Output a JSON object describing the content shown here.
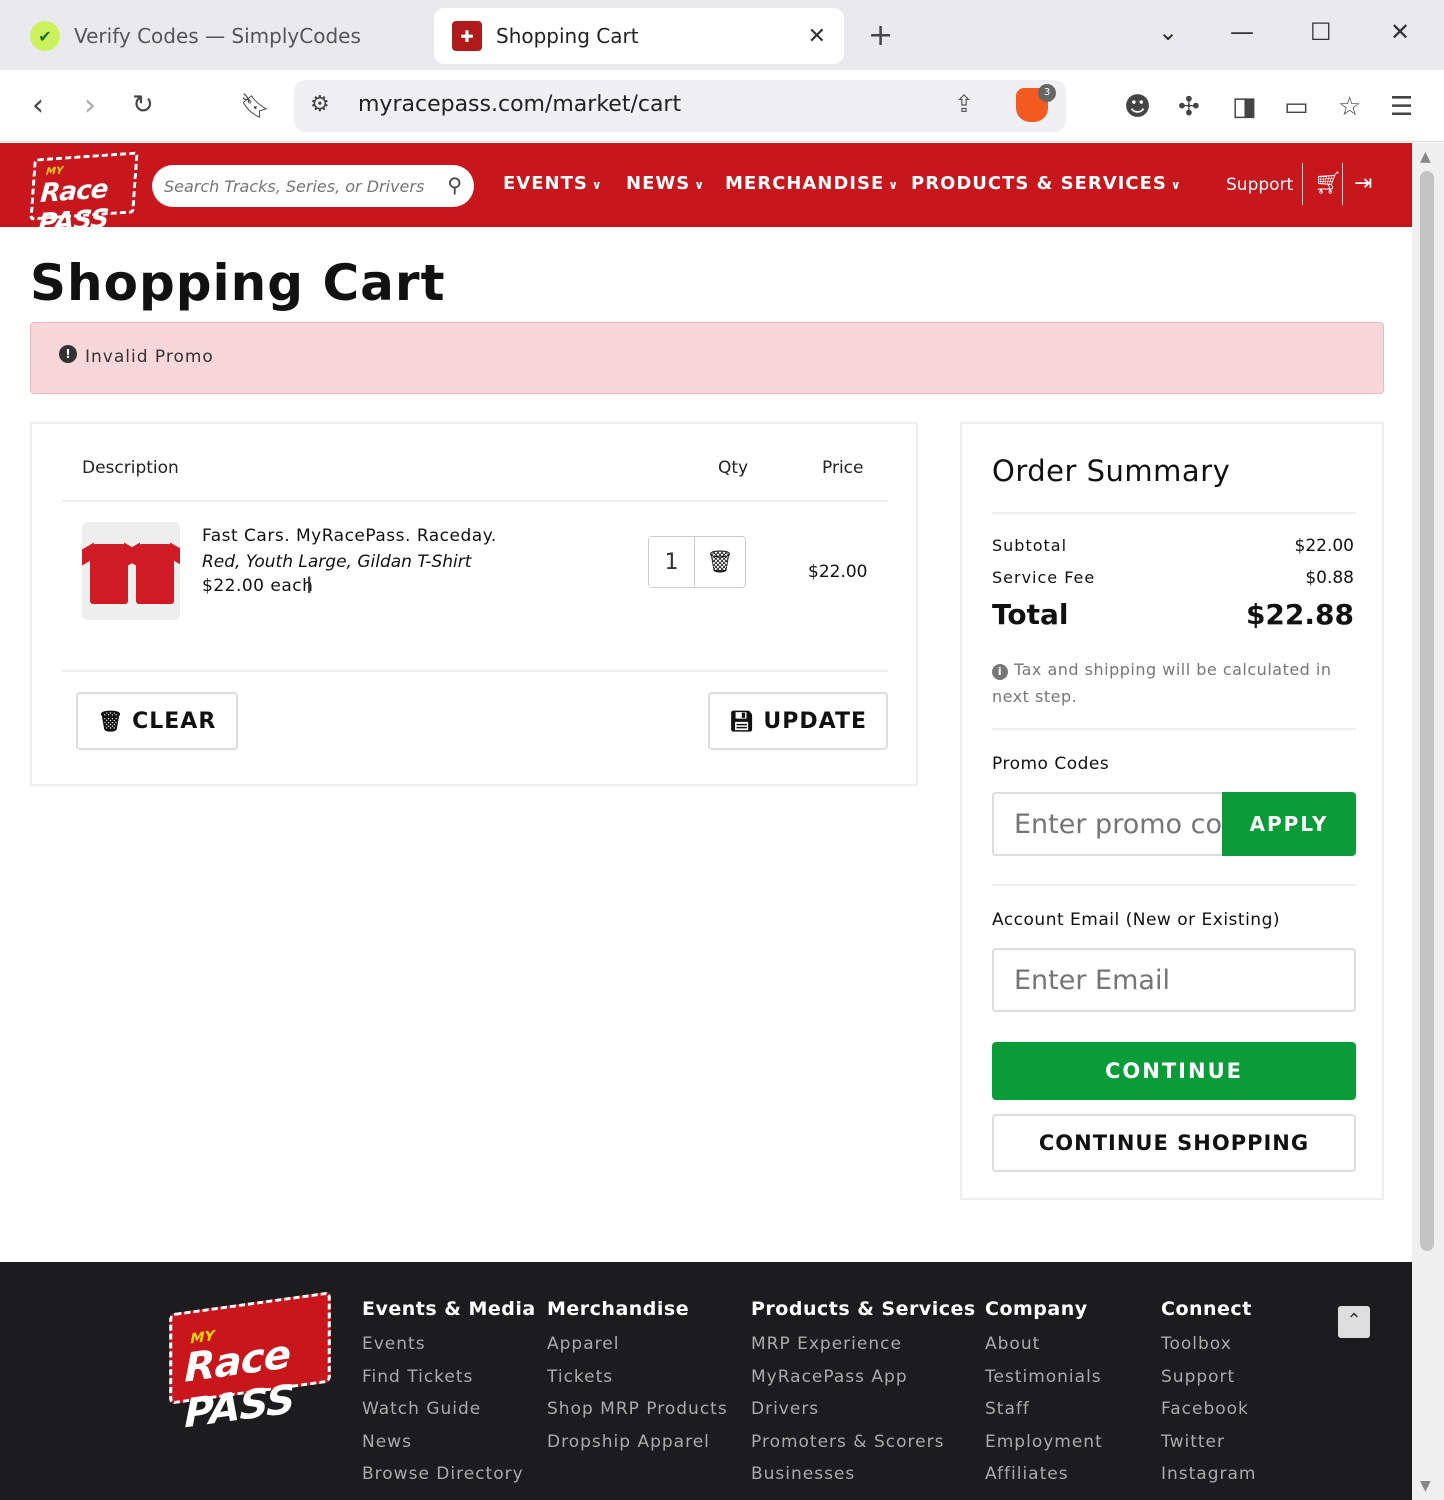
{
  "browser": {
    "tabs": [
      {
        "title": "Verify Codes — SimplyCodes",
        "active": false
      },
      {
        "title": "Shopping Cart",
        "active": true
      }
    ],
    "url": "myracepass.com/market/cart",
    "brave_badge": "3"
  },
  "site": {
    "logo_small": "MY",
    "logo_big": "Race PASS",
    "search_placeholder": "Search Tracks, Series, or Drivers",
    "nav": [
      "EVENTS",
      "NEWS",
      "MERCHANDISE",
      "PRODUCTS & SERVICES"
    ],
    "support_label": "Support"
  },
  "page": {
    "title": "Shopping Cart",
    "alert": "Invalid Promo"
  },
  "cart": {
    "headers": {
      "description": "Description",
      "qty": "Qty",
      "price": "Price"
    },
    "items": [
      {
        "name": "Fast Cars. MyRacePass. Raceday.",
        "variant": "Red, Youth Large, Gildan T-Shirt",
        "each": "$22.00 each",
        "qty": "1",
        "price": "$22.00"
      }
    ],
    "clear_label": "CLEAR",
    "update_label": "UPDATE"
  },
  "summary": {
    "title": "Order Summary",
    "subtotal_label": "Subtotal",
    "subtotal": "$22.00",
    "fee_label": "Service Fee",
    "fee": "$0.88",
    "total_label": "Total",
    "total": "$22.88",
    "tax_note": "Tax and shipping will be calculated in next step.",
    "promo_label": "Promo Codes",
    "promo_placeholder": "Enter promo code",
    "apply_label": "APPLY",
    "email_label": "Account Email (New or Existing)",
    "email_placeholder": "Enter Email",
    "continue_label": "CONTINUE",
    "continue_shopping_label": "CONTINUE SHOPPING"
  },
  "footer": {
    "columns": [
      {
        "title": "Events & Media",
        "links": [
          "Events",
          "Find Tickets",
          "Watch Guide",
          "News",
          "Browse Directory"
        ]
      },
      {
        "title": "Merchandise",
        "links": [
          "Apparel",
          "Tickets",
          "Shop MRP Products",
          "Dropship Apparel"
        ]
      },
      {
        "title": "Products & Services",
        "links": [
          "MRP Experience",
          "MyRacePass App",
          "Drivers",
          "Promoters & Scorers",
          "Businesses"
        ]
      },
      {
        "title": "Company",
        "links": [
          "About",
          "Testimonials",
          "Staff",
          "Employment",
          "Affiliates"
        ]
      },
      {
        "title": "Connect",
        "links": [
          "Toolbox",
          "Support",
          "Facebook",
          "Twitter",
          "Instagram"
        ]
      }
    ]
  },
  "colors": {
    "brand_red": "#c8161d",
    "accent_green": "#0b9c3a",
    "alert_bg": "#f8d7da",
    "footer_bg": "#1c1c1e"
  }
}
